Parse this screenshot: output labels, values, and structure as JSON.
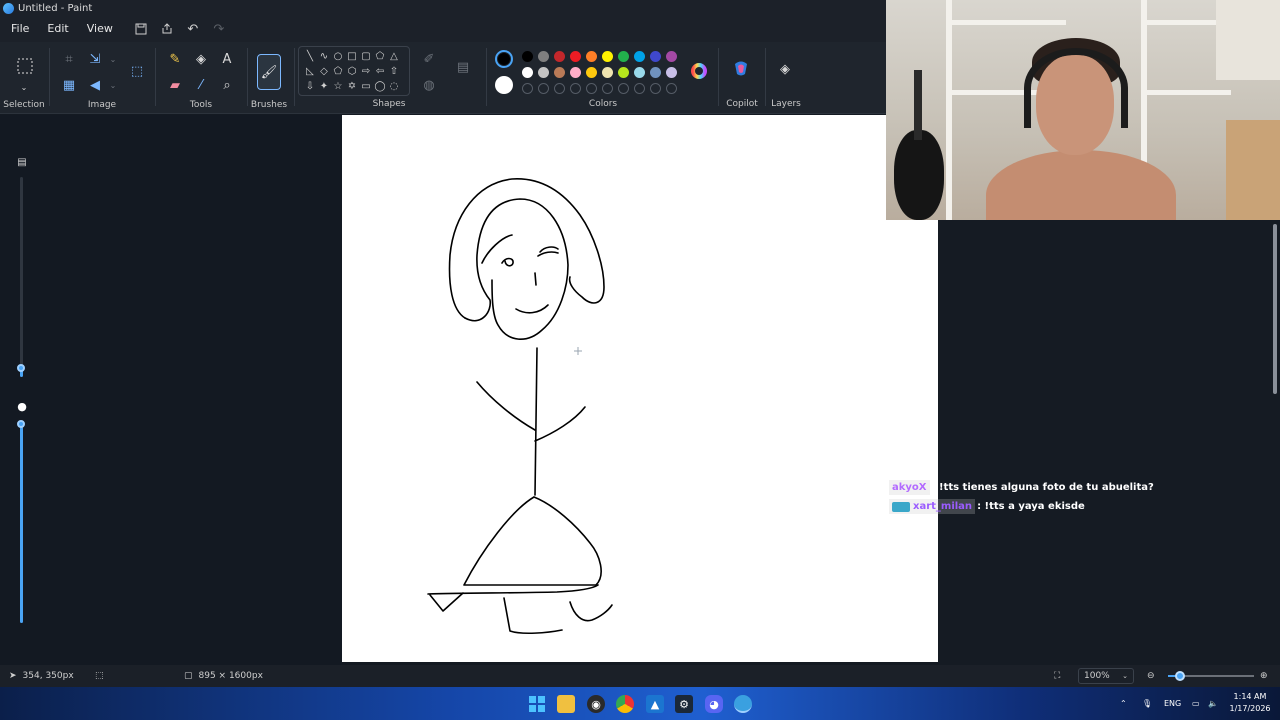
{
  "window": {
    "title": "Untitled - Paint"
  },
  "menu": {
    "file": "File",
    "edit": "Edit",
    "view": "View"
  },
  "ribbon": {
    "groups": {
      "selection": "Selection",
      "image": "Image",
      "tools": "Tools",
      "brushes": "Brushes",
      "shapes": "Shapes",
      "colors": "Colors",
      "copilot": "Copilot",
      "layers": "Layers"
    },
    "palette_row1": [
      "#000000",
      "#7f7f7f",
      "#c3272b",
      "#ed1c24",
      "#ff7f27",
      "#fff200",
      "#22b14c",
      "#00a2e8",
      "#3f48cc",
      "#a349a4"
    ],
    "palette_row2": [
      "#ffffff",
      "#c3c3c3",
      "#b97a57",
      "#ffaec9",
      "#ffc90e",
      "#efe4b0",
      "#b5e61d",
      "#99d9ea",
      "#7092be",
      "#c8bfe7"
    ],
    "primary_color": "#000000",
    "secondary_color": "#ffffff"
  },
  "chat": [
    {
      "user": "akyoX",
      "text": ": !tts tienes alguna foto de tu abuelita?"
    },
    {
      "user": "xart_milan",
      "text": ": !tts a yaya ekisde"
    }
  ],
  "status": {
    "cursor_position": "354, 350px",
    "canvas_size": "895 × 1600px",
    "zoom": "100%"
  },
  "taskbar": {
    "language": "ENG",
    "time": "1:14 AM",
    "date": "1/17/2026"
  }
}
